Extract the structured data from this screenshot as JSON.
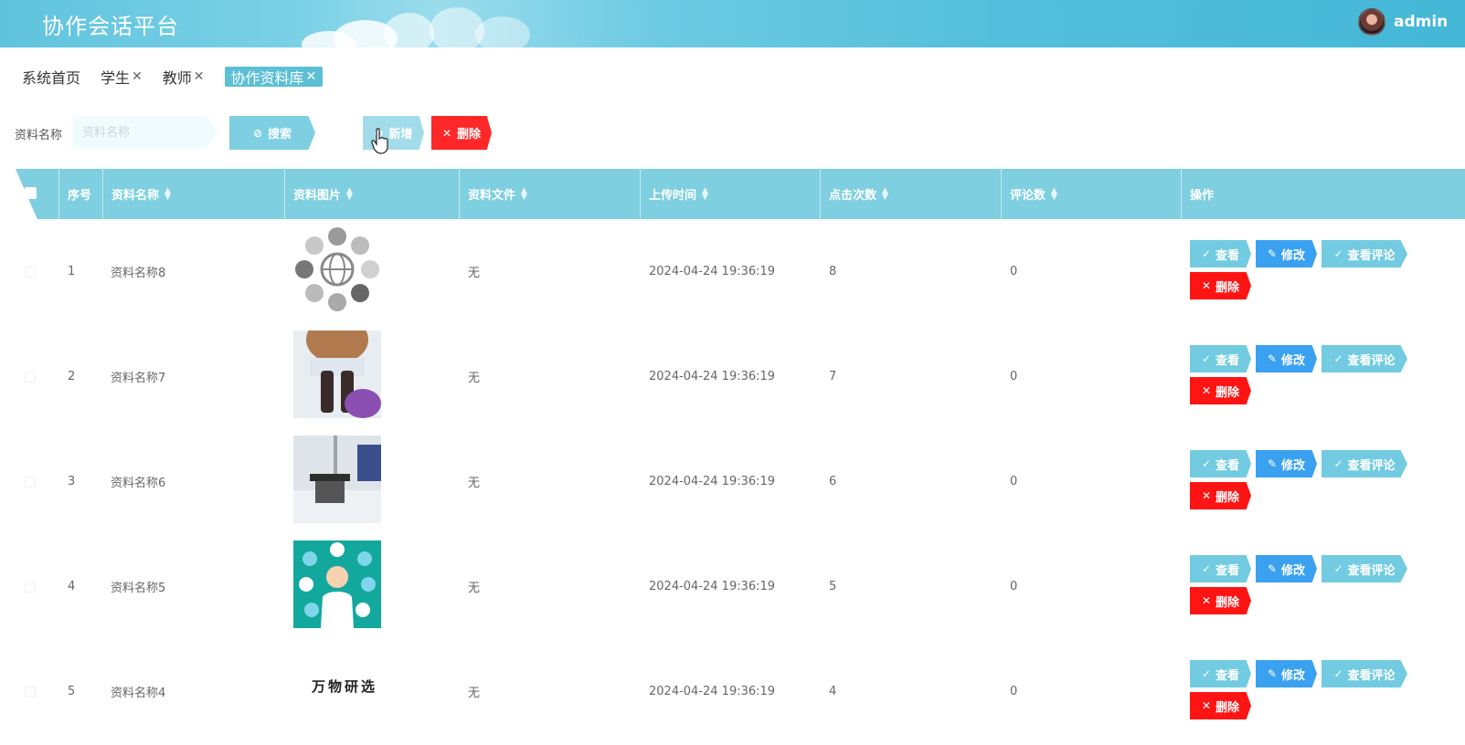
{
  "header": {
    "title": "协作会话平台",
    "username": "admin"
  },
  "tabs": [
    {
      "label": "系统首页",
      "closable": false
    },
    {
      "label": "学生",
      "closable": true
    },
    {
      "label": "教师",
      "closable": true
    },
    {
      "label": "协作资料库",
      "closable": true,
      "active": true
    }
  ],
  "search": {
    "label": "资料名称",
    "placeholder": "资料名称",
    "search_button": "搜索",
    "add_button": "新增",
    "delete_button": "删除"
  },
  "table": {
    "columns": [
      "序号",
      "资料名称",
      "资料图片",
      "资料文件",
      "上传时间",
      "点击次数",
      "评论数",
      "操作"
    ],
    "rows": [
      {
        "index": "1",
        "name": "资料名称8",
        "file": "无",
        "time": "2024-04-24 19:36:19",
        "clicks": "8",
        "comments": "0"
      },
      {
        "index": "2",
        "name": "资料名称7",
        "file": "无",
        "time": "2024-04-24 19:36:19",
        "clicks": "7",
        "comments": "0"
      },
      {
        "index": "3",
        "name": "资料名称6",
        "file": "无",
        "time": "2024-04-24 19:36:19",
        "clicks": "6",
        "comments": "0"
      },
      {
        "index": "4",
        "name": "资料名称5",
        "file": "无",
        "time": "2024-04-24 19:36:19",
        "clicks": "5",
        "comments": "0"
      },
      {
        "index": "5",
        "name": "资料名称4",
        "file": "无",
        "time": "2024-04-24 19:36:19",
        "clicks": "4",
        "comments": "0",
        "image_text": "万物研选"
      }
    ],
    "actions": {
      "view": "查看",
      "edit": "修改",
      "comment": "查看评论",
      "delete": "删除"
    }
  },
  "colors": {
    "header": "#52bedb",
    "accent": "#7ecfe0",
    "edit": "#3aa1f1",
    "danger": "#ff1414"
  }
}
